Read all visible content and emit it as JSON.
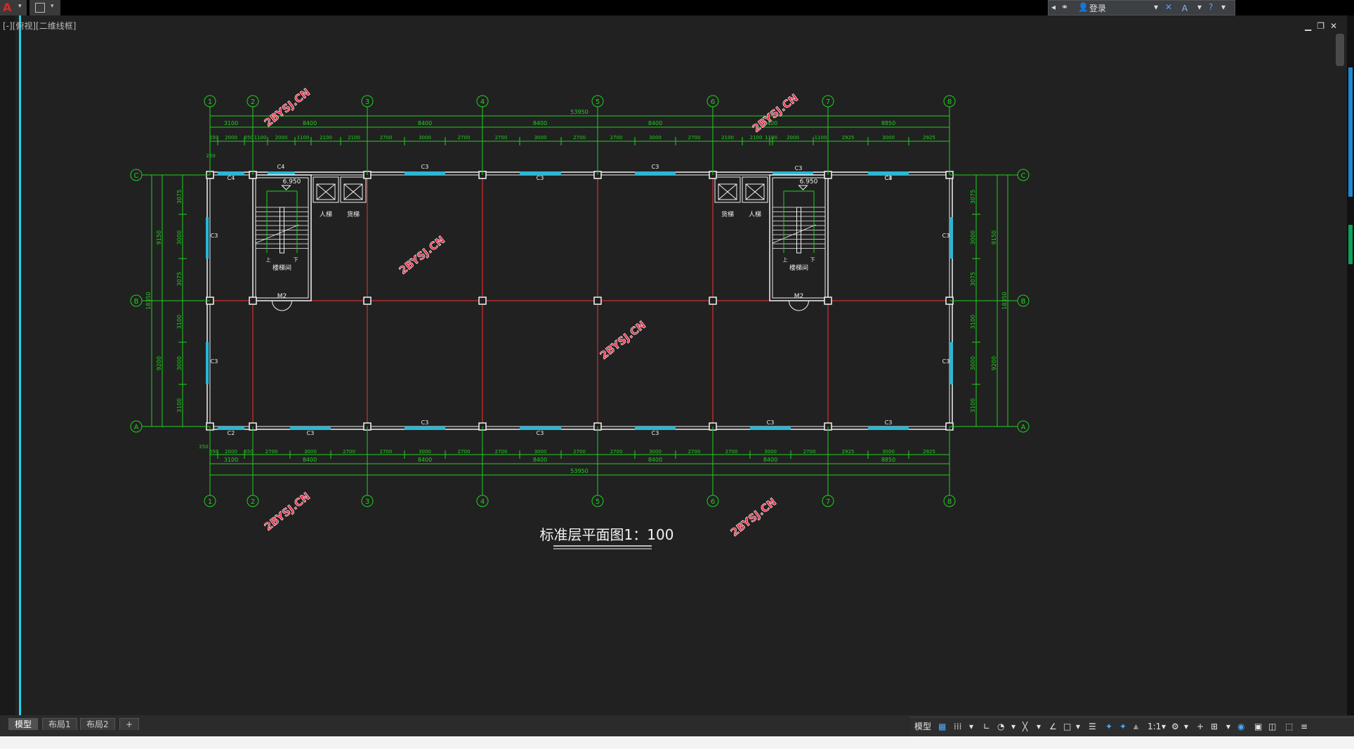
{
  "app": {
    "logo_glyph": "A",
    "menu_caret": "▾"
  },
  "infocenter": {
    "login_label": "登录"
  },
  "viewport": {
    "label": "[-][俯视][二维线框]"
  },
  "drawing": {
    "grid_x": [
      "1",
      "2",
      "3",
      "4",
      "5",
      "6",
      "7",
      "8"
    ],
    "grid_y": [
      "C",
      "B",
      "A"
    ],
    "total_dim": "53950",
    "bay_dims": [
      "3100",
      "8400",
      "8400",
      "8400",
      "8400",
      "8400",
      "8850"
    ],
    "top_detail_dims": [
      "550",
      "2000",
      "550",
      "1100",
      "2000",
      "1100",
      "2100",
      "2100",
      "2700",
      "3000",
      "2700",
      "2700",
      "3000",
      "2700",
      "2700",
      "3000",
      "2700",
      "2100",
      "2100",
      "1100",
      "2000",
      "1100",
      "2925",
      "3000",
      "2925",
      "250"
    ],
    "bottom_detail_dims": [
      "550",
      "2000",
      "550",
      "2700",
      "3000",
      "2700",
      "2700",
      "3000",
      "2700",
      "2700",
      "3000",
      "2700",
      "2700",
      "3000",
      "2700",
      "2700",
      "3000",
      "2700",
      "2925",
      "3000",
      "2925",
      "250"
    ],
    "left_dims_outer": [
      "9150",
      "9200"
    ],
    "left_total": "18350",
    "side_detail": [
      "3075",
      "3000",
      "3075",
      "3100",
      "3000",
      "3100"
    ],
    "side_small": [
      "250",
      "250"
    ],
    "window_labels": [
      "C4",
      "C4",
      "C3",
      "C3",
      "C3",
      "C3",
      "C4",
      "C3",
      "C3",
      "C3",
      "C3",
      "C2",
      "C3",
      "C3",
      "C3",
      "C3",
      "C3",
      "C3",
      "C3"
    ],
    "door_label": "M2",
    "level_label": "6.950",
    "room_labels": {
      "stair": "楼梯间",
      "passenger_lift": "人梯",
      "freight_lift": "货梯",
      "up": "上",
      "down": "下"
    },
    "watermark": "2BYSJ.CN",
    "title": "标准层平面图1：100",
    "colors": {
      "grid": "#1fd11f",
      "axis": "#ff3030",
      "wall": "#f2f2f2",
      "window": "#26b8d8",
      "watermark": "#e8304a"
    }
  },
  "layout_tabs": [
    "模型",
    "布局1",
    "布局2"
  ],
  "add_tab": "+",
  "status": {
    "model_label": "模型",
    "scale": "1:1"
  }
}
